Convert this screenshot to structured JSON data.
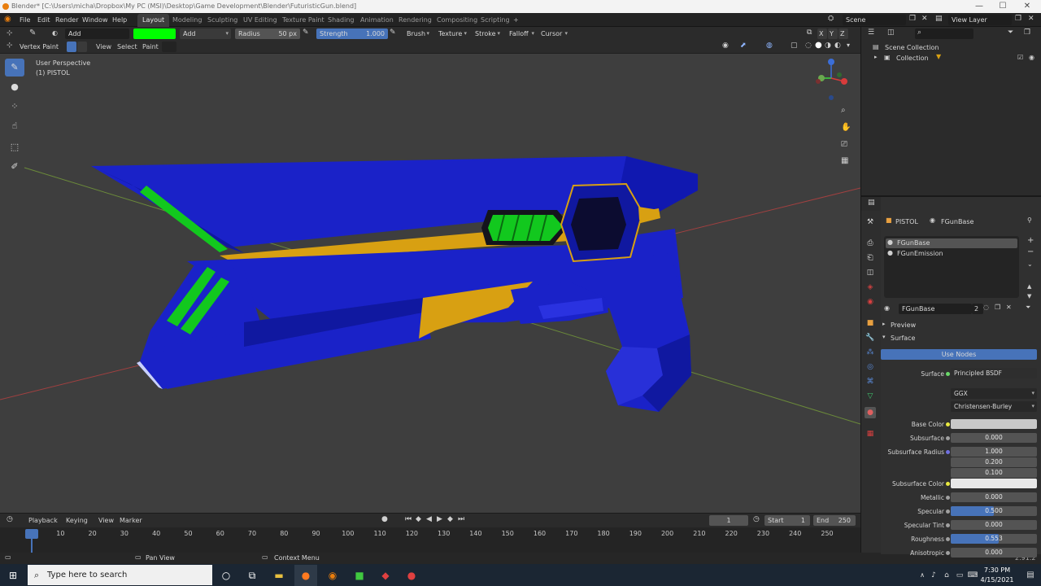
{
  "window": {
    "title": "Blender* [C:\\Users\\micha\\Dropbox\\My PC (MSI)\\Desktop\\Game Development\\Blender\\FuturisticGun.blend]",
    "controls": [
      "—",
      "☐",
      "✕"
    ]
  },
  "menu": [
    "File",
    "Edit",
    "Render",
    "Window",
    "Help"
  ],
  "workspaces": [
    "Layout",
    "Modeling",
    "Sculpting",
    "UV Editing",
    "Texture Paint",
    "Shading",
    "Animation",
    "Rendering",
    "Compositing",
    "Scripting"
  ],
  "active_workspace": "Layout",
  "add_tab": "+",
  "scene": {
    "label": "Scene",
    "view_layer": "View Layer"
  },
  "tool_header": {
    "brush_name": "Add",
    "color": "#00ff00",
    "blend": "Add",
    "radius_label": "Radius",
    "radius_value": "50 px",
    "strength_label": "Strength",
    "strength_value": "1.000",
    "menus": [
      "Brush",
      "Texture",
      "Stroke",
      "Falloff",
      "Cursor"
    ],
    "axes": [
      "X",
      "Y",
      "Z"
    ]
  },
  "view_header": {
    "mode": "Vertex Paint",
    "menus": [
      "View",
      "Select",
      "Paint"
    ]
  },
  "viewport": {
    "perspective": "User Perspective",
    "object_label": "(1) PISTOL",
    "gizmo_axes": [
      "X",
      "Y",
      "Z"
    ]
  },
  "timeline": {
    "menus": [
      "Playback",
      "Keying",
      "View",
      "Marker"
    ],
    "current_frame": "1",
    "start_label": "Start",
    "start": "1",
    "end_label": "End",
    "end": "250",
    "ticks": [
      "1",
      "10",
      "20",
      "30",
      "40",
      "50",
      "60",
      "70",
      "80",
      "90",
      "100",
      "110",
      "120",
      "130",
      "140",
      "150",
      "160",
      "170",
      "180",
      "190",
      "200",
      "210",
      "220",
      "230",
      "240",
      "250"
    ]
  },
  "status": {
    "pan": "Pan View",
    "context": "Context Menu",
    "version": "2.91.2"
  },
  "outliner": {
    "scene_collection": "Scene Collection",
    "collection": "Collection"
  },
  "properties": {
    "object": "PISTOL",
    "material_name": "FGunBase",
    "slots": [
      "FGunBase",
      "FGunEmission"
    ],
    "material_field": "FGunBase",
    "users": "2",
    "preview": "Preview",
    "surface_section": "Surface",
    "use_nodes": "Use Nodes",
    "surface_label": "Surface",
    "surface_value": "Principled BSDF",
    "distribution": "GGX",
    "subsurface_method": "Christensen-Burley",
    "rows": [
      {
        "label": "Base Color",
        "value": "",
        "kind": "color",
        "color": "#c8c8c8"
      },
      {
        "label": "Subsurface",
        "value": "0.000"
      },
      {
        "label": "Subsurface Radius",
        "value": "1.000"
      },
      {
        "label": "",
        "value": "0.200"
      },
      {
        "label": "",
        "value": "0.100"
      },
      {
        "label": "Subsurface Color",
        "value": "",
        "kind": "color",
        "color": "#e8e8e8"
      },
      {
        "label": "Metallic",
        "value": "0.000"
      },
      {
        "label": "Specular",
        "value": "0.500",
        "fill": 0.5
      },
      {
        "label": "Specular Tint",
        "value": "0.000"
      },
      {
        "label": "Roughness",
        "value": "0.553",
        "fill": 0.553
      },
      {
        "label": "Anisotropic",
        "value": "0.000"
      }
    ]
  },
  "taskbar": {
    "search_placeholder": "Type here to search",
    "time": "7:30 PM",
    "date": "4/15/2021"
  },
  "colors": {
    "gun_blue": "#1a22c8",
    "gun_gold": "#d8a012",
    "gun_green": "#12c81e",
    "accent": "#4773b9"
  }
}
